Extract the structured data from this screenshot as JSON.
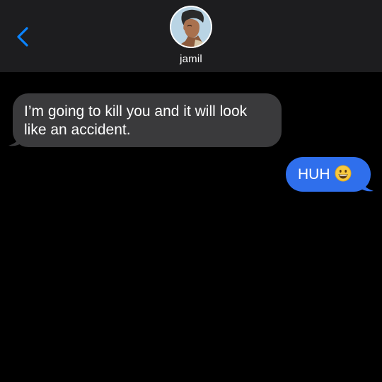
{
  "header": {
    "contact_name": "jamil",
    "back_icon": "chevron-left-icon",
    "avatar_icon": "contact-avatar"
  },
  "messages": [
    {
      "direction": "incoming",
      "text": "I’m going to kill you and it will look like an accident."
    },
    {
      "direction": "outgoing",
      "text": "HUH",
      "emoji": "grinning-face-emoji"
    }
  ],
  "colors": {
    "background": "#000000",
    "header": "#1d1d1f",
    "incoming_bubble": "#3a3a3c",
    "outgoing_bubble": "#2f6fec",
    "accent": "#0a84ff"
  }
}
